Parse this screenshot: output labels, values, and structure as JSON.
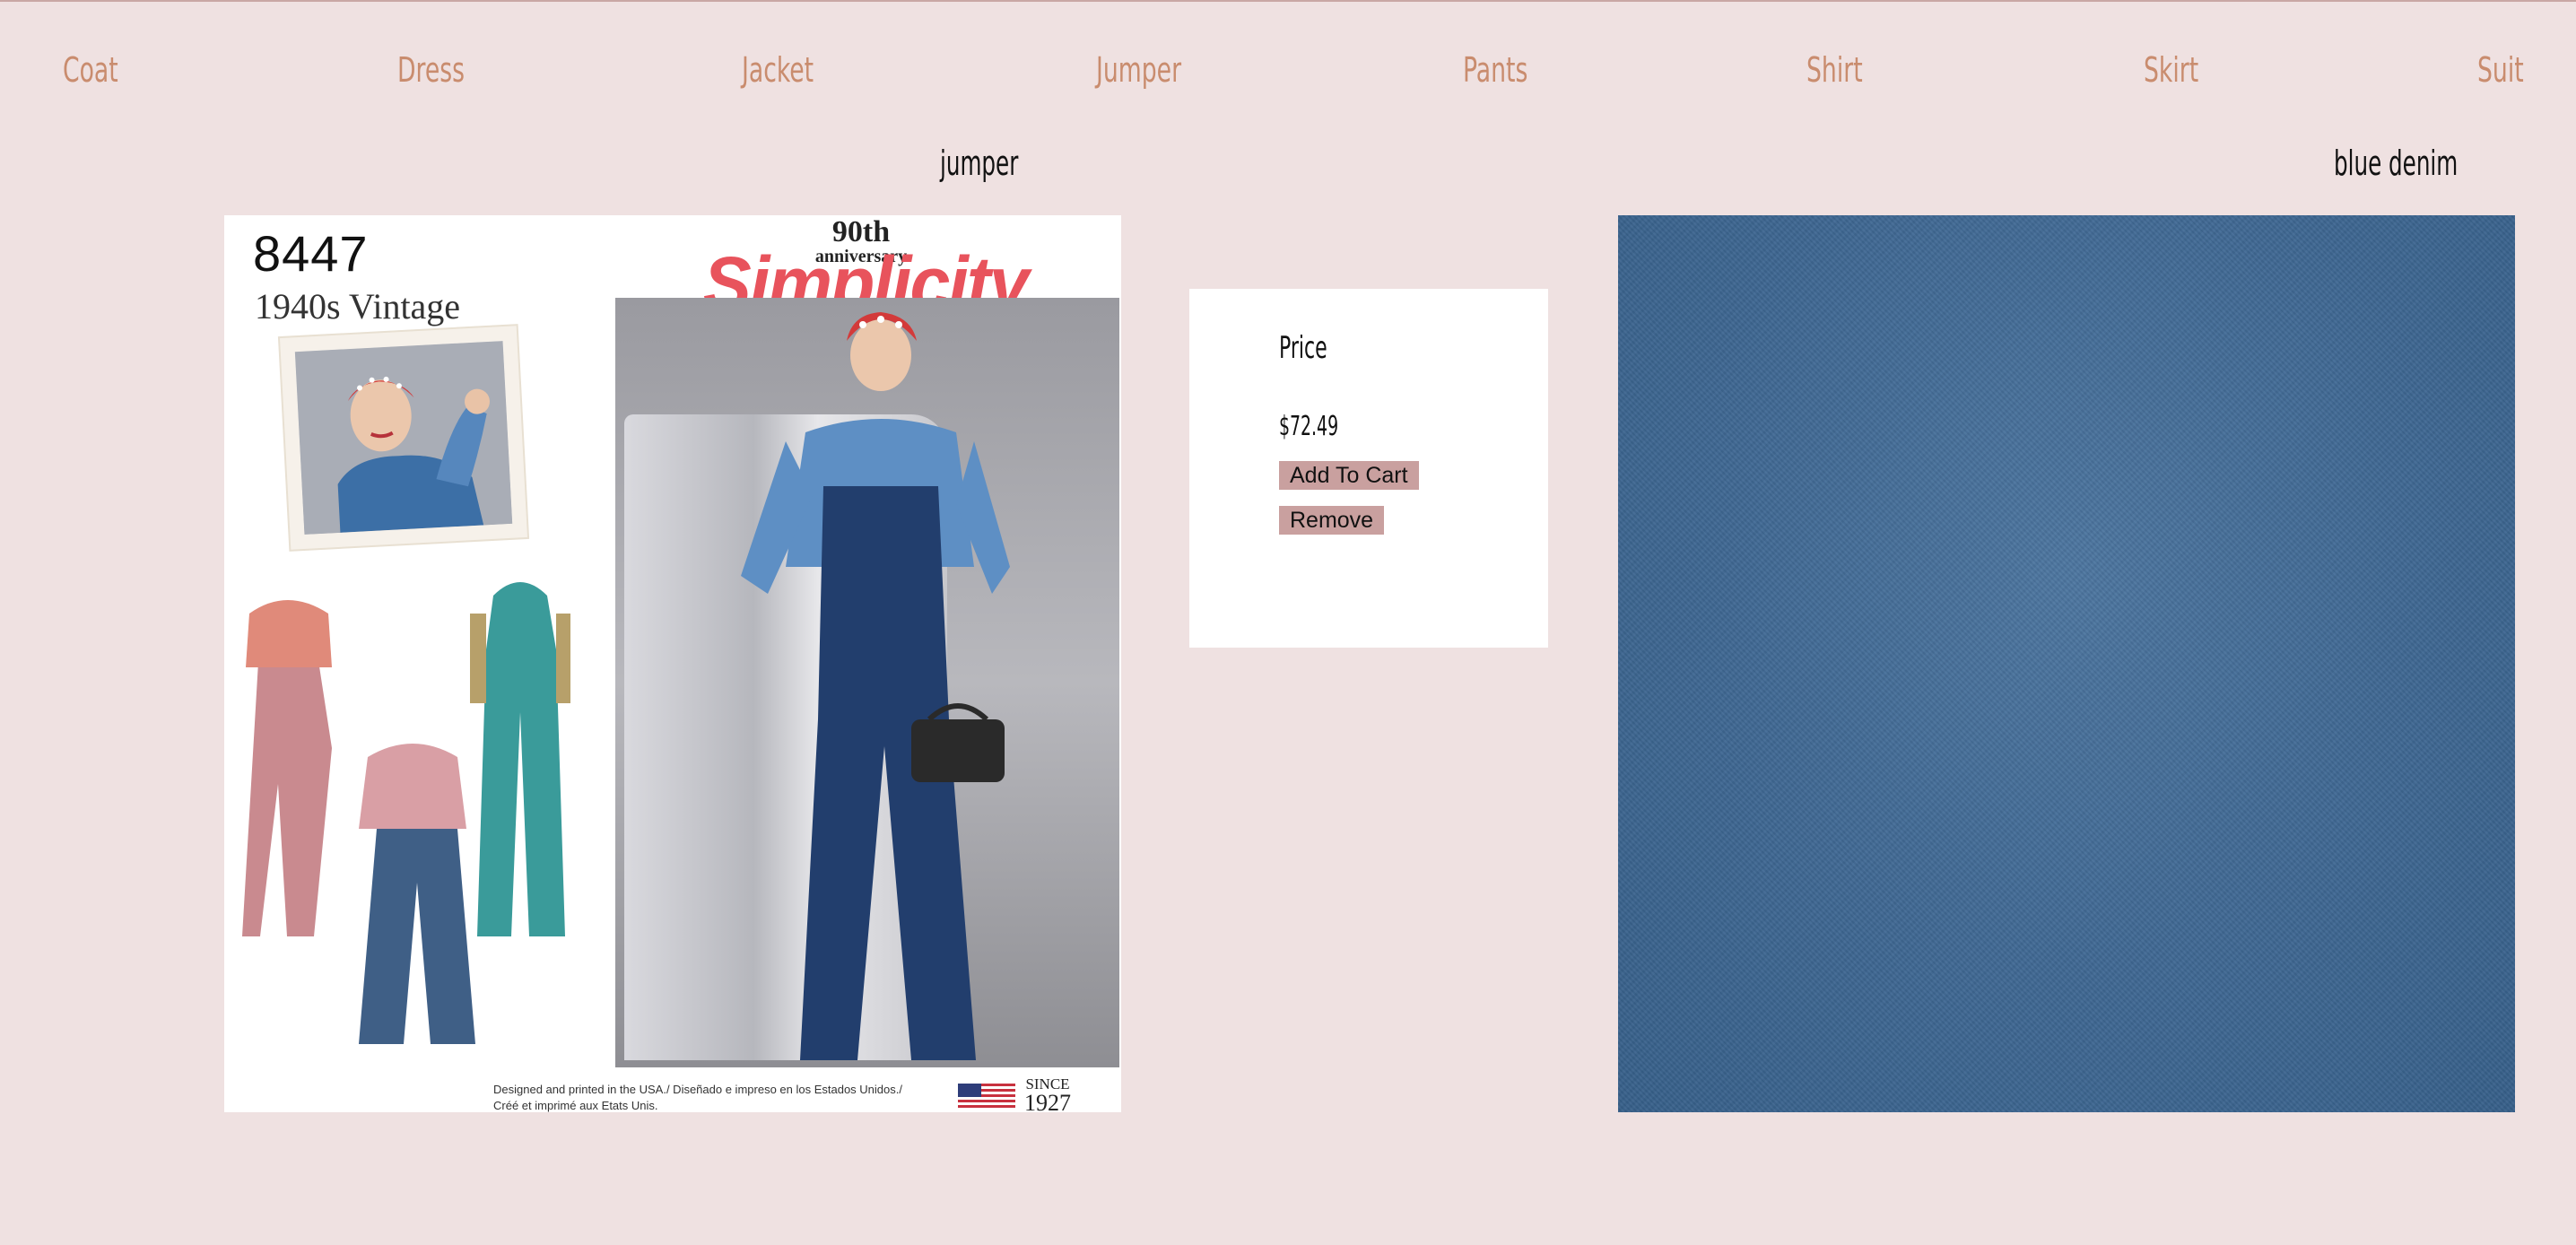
{
  "nav": {
    "items": [
      {
        "label": "Coat"
      },
      {
        "label": "Dress"
      },
      {
        "label": "Jacket"
      },
      {
        "label": "Jumper"
      },
      {
        "label": "Pants"
      },
      {
        "label": "Shirt"
      },
      {
        "label": "Skirt"
      },
      {
        "label": "Suit"
      }
    ]
  },
  "pattern": {
    "heading": "jumper",
    "image": {
      "number": "8447",
      "era": "1940s Vintage",
      "anniversary_top": "90th",
      "anniversary_bottom": "anniversary",
      "brand": "Simplicity",
      "footer": "Designed and printed in the USA./ Diseñado e impreso en los Estados Unidos./ Créé et imprimé aux Etats Unis.",
      "since_label": "SINCE",
      "since_year": "1927"
    }
  },
  "purchase": {
    "price_label": "Price",
    "price_value": "$72.49",
    "add_button": "Add To Cart",
    "remove_button": "Remove"
  },
  "fabric": {
    "heading": "blue denim",
    "color": "#3f6893"
  },
  "colors": {
    "background": "#efe1e1",
    "nav_text": "#c98c6e",
    "button": "#c9a09f",
    "brand": "#e8535c"
  }
}
